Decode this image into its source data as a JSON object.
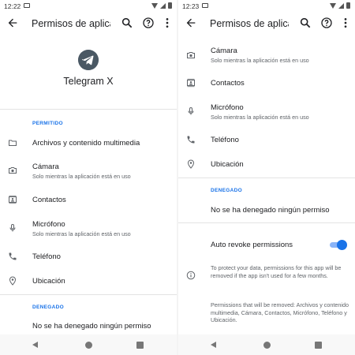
{
  "left": {
    "status": {
      "time": "12:22"
    },
    "appbar": {
      "title": "Permisos de aplicac"
    },
    "app": {
      "name": "Telegram X",
      "icon": "telegram-logo"
    },
    "allowed": {
      "header": "PERMITIDO",
      "items": [
        {
          "label": "Archivos y contenido multimedia",
          "sub": "",
          "icon": "folder-icon"
        },
        {
          "label": "Cámara",
          "sub": "Solo mientras la aplicación está en uso",
          "icon": "camera-icon"
        },
        {
          "label": "Contactos",
          "sub": "",
          "icon": "contacts-icon"
        },
        {
          "label": "Micrófono",
          "sub": "Solo mientras la aplicación está en uso",
          "icon": "microphone-icon"
        },
        {
          "label": "Teléfono",
          "sub": "",
          "icon": "phone-icon"
        },
        {
          "label": "Ubicación",
          "sub": "",
          "icon": "location-icon"
        }
      ]
    },
    "denied": {
      "header": "DENEGADO",
      "empty": "No se ha denegado ningún permiso"
    }
  },
  "right": {
    "status": {
      "time": "12:23"
    },
    "appbar": {
      "title": "Permisos de aplicac"
    },
    "allowed": {
      "items": [
        {
          "label": "Cámara",
          "sub": "Solo mientras la aplicación está en uso",
          "icon": "camera-icon"
        },
        {
          "label": "Contactos",
          "sub": "",
          "icon": "contacts-icon"
        },
        {
          "label": "Micrófono",
          "sub": "Solo mientras la aplicación está en uso",
          "icon": "microphone-icon"
        },
        {
          "label": "Teléfono",
          "sub": "",
          "icon": "phone-icon"
        },
        {
          "label": "Ubicación",
          "sub": "",
          "icon": "location-icon"
        }
      ]
    },
    "denied": {
      "header": "DENEGADO",
      "empty": "No se ha denegado ningún permiso"
    },
    "auto_revoke": {
      "label": "Auto revoke permissions",
      "enabled": true
    },
    "info": {
      "text": "To protect your data, permissions for this app will be removed if the app isn't used for a few months.",
      "removed": "Permissions that will be removed: Archivos y contenido multimedia, Cámara, Contactos, Micrófono, Teléfono y Ubicación."
    }
  },
  "colors": {
    "accent": "#1a73e8",
    "toggle_track": "#8ab4f8",
    "text": "#202124",
    "secondary_text": "#5f6368"
  }
}
